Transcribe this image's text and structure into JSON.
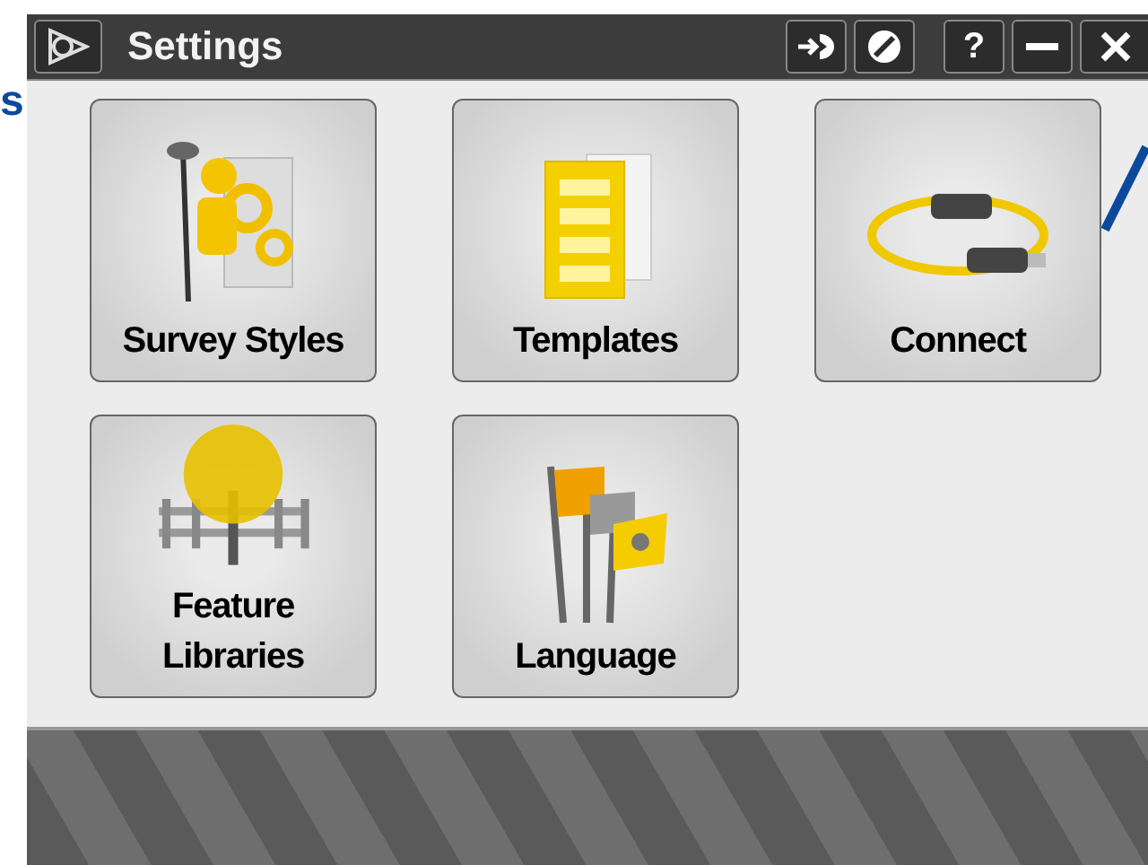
{
  "margin_note": {
    "text": "s"
  },
  "window": {
    "title": "Settings",
    "help_label": "?"
  },
  "tiles": [
    {
      "label": "Survey Styles",
      "kind": "survey"
    },
    {
      "label": "Templates",
      "kind": "templates"
    },
    {
      "label": "Connect",
      "kind": "connect"
    },
    {
      "label": "Feature Libraries",
      "kind": "library"
    },
    {
      "label": "Language",
      "kind": "language"
    }
  ]
}
